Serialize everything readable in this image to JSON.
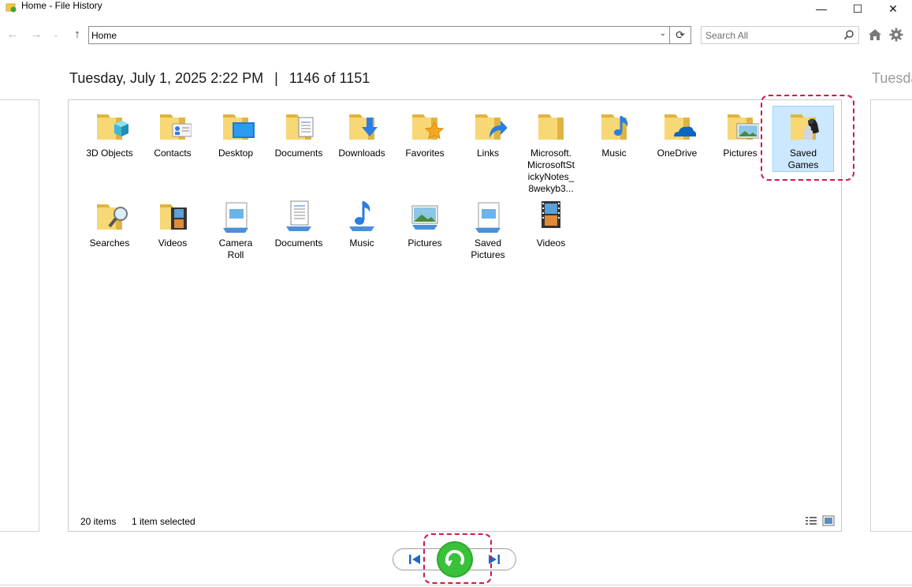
{
  "window": {
    "title": "Home - File History",
    "min_glyph": "—",
    "max_glyph": "☐",
    "close_glyph": "✕"
  },
  "toolbar": {
    "back_glyph": "←",
    "forward_glyph": "→",
    "dropdown_glyph": "⌄",
    "up_glyph": "↑",
    "address": "Home",
    "address_drop_glyph": "⌄",
    "refresh_glyph": "⟳",
    "search_placeholder": "Search All"
  },
  "snapshot": {
    "date": "Tuesday, July 1, 2025 2:22 PM",
    "separator": "|",
    "position": "1146 of 1151",
    "next_date_partial": "Tuesda"
  },
  "items": [
    {
      "label": "3D Objects",
      "icon": "folder-3d-objects-icon"
    },
    {
      "label": "Contacts",
      "icon": "folder-contacts-icon"
    },
    {
      "label": "Desktop",
      "icon": "folder-desktop-icon"
    },
    {
      "label": "Documents",
      "icon": "folder-documents-icon"
    },
    {
      "label": "Downloads",
      "icon": "folder-downloads-icon"
    },
    {
      "label": "Favorites",
      "icon": "folder-favorites-icon"
    },
    {
      "label": "Links",
      "icon": "folder-links-icon"
    },
    {
      "label": "Microsoft.\nMicrosoftSt\nickyNotes_\n8wekyb3...",
      "icon": "folder-icon"
    },
    {
      "label": "Music",
      "icon": "folder-music-icon"
    },
    {
      "label": "OneDrive",
      "icon": "folder-onedrive-icon"
    },
    {
      "label": "Pictures",
      "icon": "folder-pictures-icon"
    },
    {
      "label": "Saved\nGames",
      "icon": "folder-saved-games-icon",
      "selected": true
    },
    {
      "label": "Searches",
      "icon": "folder-searches-icon"
    },
    {
      "label": "Videos",
      "icon": "folder-videos-icon"
    },
    {
      "label": "Camera\nRoll",
      "icon": "library-camera-roll-icon"
    },
    {
      "label": "Documents",
      "icon": "library-documents-icon"
    },
    {
      "label": "Music",
      "icon": "library-music-icon"
    },
    {
      "label": "Pictures",
      "icon": "library-pictures-icon"
    },
    {
      "label": "Saved\nPictures",
      "icon": "library-saved-pictures-icon"
    },
    {
      "label": "Videos",
      "icon": "library-videos-icon"
    }
  ],
  "status": {
    "count": "20 items",
    "selection": "1 item selected"
  },
  "colors": {
    "folder": "#f8d775",
    "folder_dark": "#e0b441",
    "selection": "#cce8ff",
    "highlight": "#d0164a",
    "restore_green": "#2dab2d",
    "nav_blue": "#1b6ac9"
  }
}
